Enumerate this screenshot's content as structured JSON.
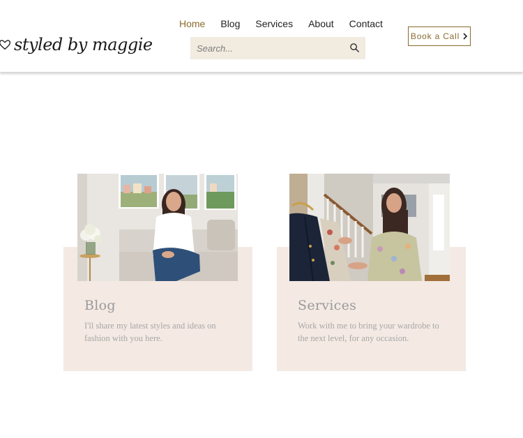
{
  "brand": {
    "logo_text": "styled by maggie"
  },
  "nav": {
    "items": [
      {
        "label": "Home",
        "active": true
      },
      {
        "label": "Blog",
        "active": false
      },
      {
        "label": "Services",
        "active": false
      },
      {
        "label": "About",
        "active": false
      },
      {
        "label": "Contact",
        "active": false
      }
    ]
  },
  "search": {
    "placeholder": "Search..."
  },
  "cta": {
    "label": "Book a Call"
  },
  "cards": [
    {
      "title": "Blog",
      "description": "I'll share my latest styles and ideas on fashion with you here."
    },
    {
      "title": "Services",
      "description": "Work with me to bring your wardrobe to the next level, for any occasion."
    }
  ],
  "colors": {
    "accent": "#8a6a2d",
    "card_bg": "#f4e9e3",
    "search_bg": "#f1ebe0"
  }
}
